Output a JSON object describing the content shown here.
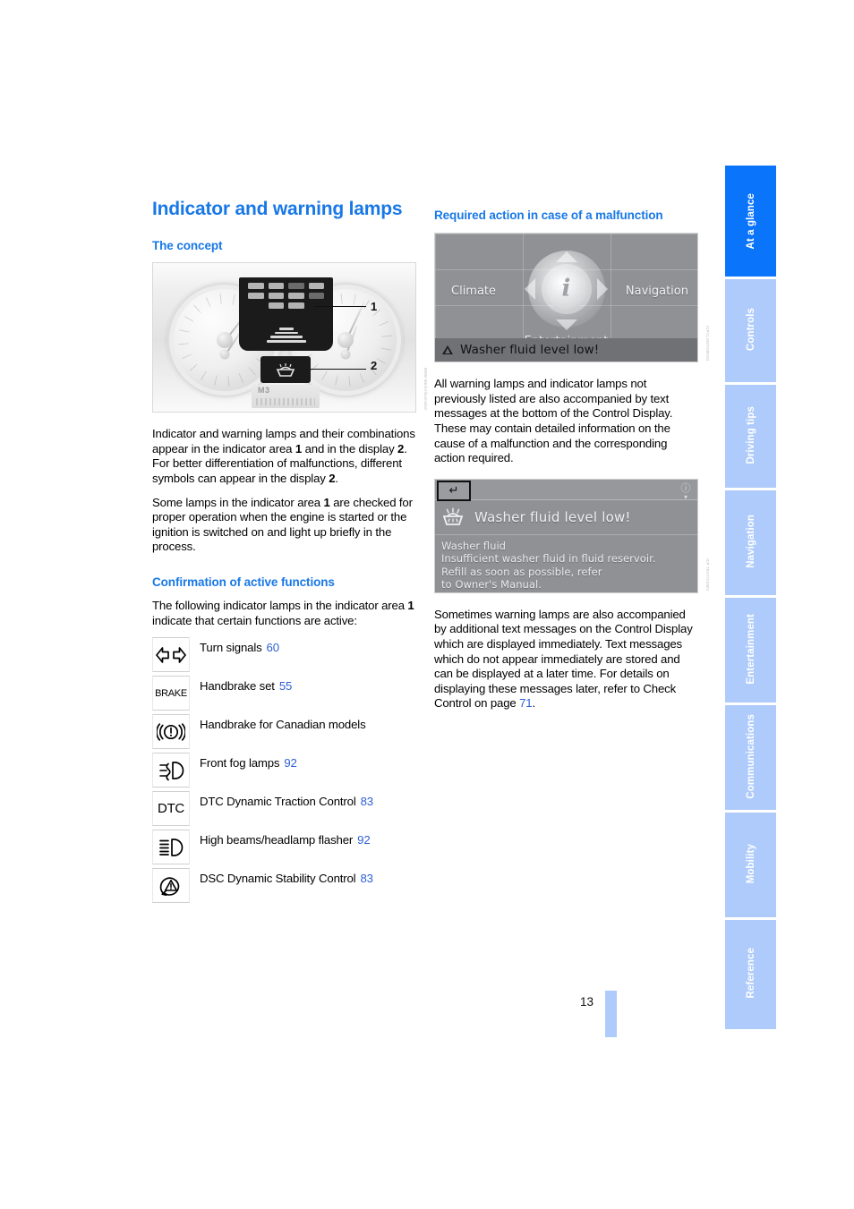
{
  "page": {
    "number": "13"
  },
  "left_column": {
    "title": "Indicator and warning lamps",
    "section1_heading": "The concept",
    "figure1": {
      "callout_1": "1",
      "callout_2": "2",
      "lcd_text": "M3",
      "credit": "BMW-Werk/Illustration"
    },
    "paragraph1": "Indicator and warning lamps and their combinations appear in the indicator area 1 and in the display 2. For better differentiation of malfunctions, different symbols can appear in the display 2.",
    "paragraph1_parts": {
      "a": "Indicator and warning lamps and their combinations appear in the indicator area ",
      "b1": "1",
      "c": " and in the display ",
      "b2": "2",
      "d": ". For better differentiation of malfunctions, different symbols can appear in the display ",
      "b3": "2",
      "e": "."
    },
    "paragraph2_parts": {
      "a": "Some lamps in the indicator area ",
      "b": "1",
      "c": " are checked for proper operation when the engine is started or the ignition is switched on and light up briefly in the process."
    },
    "section2_heading": "Confirmation of active functions",
    "paragraph3_parts": {
      "a": "The following indicator lamps in the indicator area ",
      "b": "1",
      "c": " indicate that certain functions are active:"
    },
    "lamps": [
      {
        "icon": "turn-signals-icon",
        "label": "Turn signals",
        "page": "60"
      },
      {
        "icon": "brake-icon",
        "label": "Handbrake set",
        "page": "55"
      },
      {
        "icon": "handbrake-canada-icon",
        "label": "Handbrake for Canadian models",
        "page": ""
      },
      {
        "icon": "front-fog-lamp-icon",
        "label": "Front fog lamps",
        "page": "92"
      },
      {
        "icon": "dtc-icon",
        "label": "DTC Dynamic Traction Control",
        "page": "83"
      },
      {
        "icon": "high-beam-icon",
        "label": "High beams/headlamp flasher",
        "page": "92"
      },
      {
        "icon": "dsc-icon",
        "label": "DSC Dynamic Stability Control",
        "page": "83"
      }
    ],
    "brake_icon_text": "BRAKE",
    "dtc_icon_text": "DTC"
  },
  "right_column": {
    "section_heading": "Required action in case of a malfunction",
    "figure_menu": {
      "climate": "Climate",
      "navigation": "Navigation",
      "entertainment": "Entertainment",
      "center_icon": "info-icon",
      "status_message": "Washer fluid level low!",
      "credit": "ICP11 MOTORING"
    },
    "paragraph1": "All warning lamps and indicator lamps not previously listed are also accompanied by text messages at the bottom of the Control Display. These may contain detailed information on the cause of a malfunction and the corresponding action required.",
    "figure_message": {
      "back_label": "back-arrow-icon",
      "info_label": "info-icon",
      "headline": "Washer fluid level low!",
      "body_line1": "Washer fluid",
      "body_line2": "Insufficient washer fluid in fluid reservoir.",
      "body_line3": "Refill as soon as possible, refer",
      "body_line4": "to Owner's Manual.",
      "credit": "ICP TEXT/CDWV"
    },
    "paragraph2_parts": {
      "a": "Sometimes warning lamps are also accompanied by additional text messages on the Control Display which are displayed immediately. Text messages which do not appear immediately are stored and can be displayed at a later time. For details on displaying these messages later, refer to Check Control on page ",
      "page": "71",
      "b": "."
    }
  },
  "tabs": [
    {
      "label": "At a glance",
      "active": true
    },
    {
      "label": "Controls",
      "active": false
    },
    {
      "label": "Driving tips",
      "active": false
    },
    {
      "label": "Navigation",
      "active": false
    },
    {
      "label": "Entertainment",
      "active": false
    },
    {
      "label": "Communications",
      "active": false
    },
    {
      "label": "Mobility",
      "active": false
    },
    {
      "label": "Reference",
      "active": false
    }
  ],
  "colors": {
    "accent_blue": "#1878e6",
    "tab_active": "#0a74fb",
    "tab_idle": "#aecbfb",
    "page_ref_blue": "#2d5fd4"
  }
}
